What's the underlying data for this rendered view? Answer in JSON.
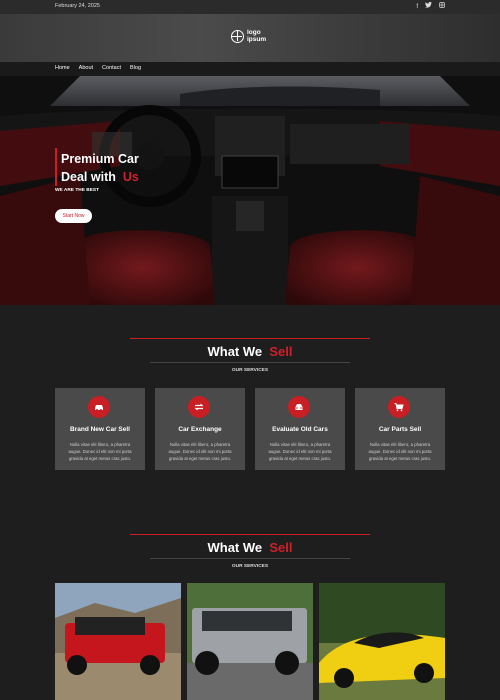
{
  "topbar": {
    "date": "February 24, 2025",
    "socials": [
      "facebook-icon",
      "twitter-icon",
      "instagram-icon"
    ]
  },
  "header": {
    "logo_text_line1": "logo",
    "logo_text_line2": "ipsum"
  },
  "nav": {
    "items": [
      {
        "label": "Home"
      },
      {
        "label": "About"
      },
      {
        "label": "Contact"
      },
      {
        "label": "Blog"
      }
    ]
  },
  "hero": {
    "title_line1": "Premium Car",
    "title_line2_a": "Deal with",
    "title_line2_b": "Us",
    "subtitle": "WE ARE THE BEST",
    "button_label": "Start Now"
  },
  "services": {
    "heading_a": "What We",
    "heading_b": "Sell",
    "eyebrow": "OUR SERVICES",
    "cards": [
      {
        "title": "Brand New Car Sell",
        "icon": "car-icon",
        "desc": "Nulla vitae elit libero, a pharetra augue. Donec id elit non mi porta gravida at eget metus cras justo."
      },
      {
        "title": "Car Exchange",
        "icon": "exchange-icon",
        "desc": "Nulla vitae elit libero, a pharetra augue. Donec id elit non mi porta gravida at eget metus cras justo."
      },
      {
        "title": "Evaluate Old Cars",
        "icon": "car-front-icon",
        "desc": "Nulla vitae elit libero, a pharetra augue. Donec id elit non mi porta gravida at eget metus cras justo."
      },
      {
        "title": "Car Parts Sell",
        "icon": "cart-icon",
        "desc": "Nulla vitae elit libero, a pharetra augue. Donec id elit non mi porta gravida at eget metus cras justo."
      }
    ]
  },
  "gallery_section": {
    "heading_a": "What We",
    "heading_b": "Sell",
    "eyebrow": "OUR SERVICES"
  },
  "colors": {
    "accent": "#c81e24",
    "background": "#1e1e1e",
    "card": "#4a4a4a"
  }
}
